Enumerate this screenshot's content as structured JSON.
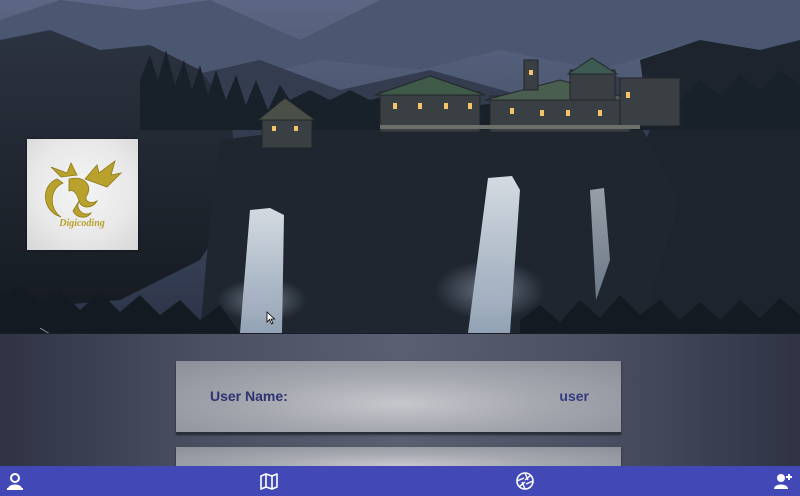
{
  "logo": {
    "text": "Digicoding",
    "icon": "dragon-logo"
  },
  "login_form": {
    "username_label": "User Name:",
    "username_value": "user"
  },
  "nav": {
    "items": [
      {
        "icon": "user-icon",
        "label": ""
      },
      {
        "icon": "map-icon",
        "label": ""
      },
      {
        "icon": "camera-aperture-icon",
        "label": ""
      },
      {
        "icon": "add-user-icon",
        "label": ""
      }
    ]
  },
  "colors": {
    "nav_background": "#4249b7",
    "label_color": "#2e3270",
    "panel_background": "#4a4f62"
  }
}
